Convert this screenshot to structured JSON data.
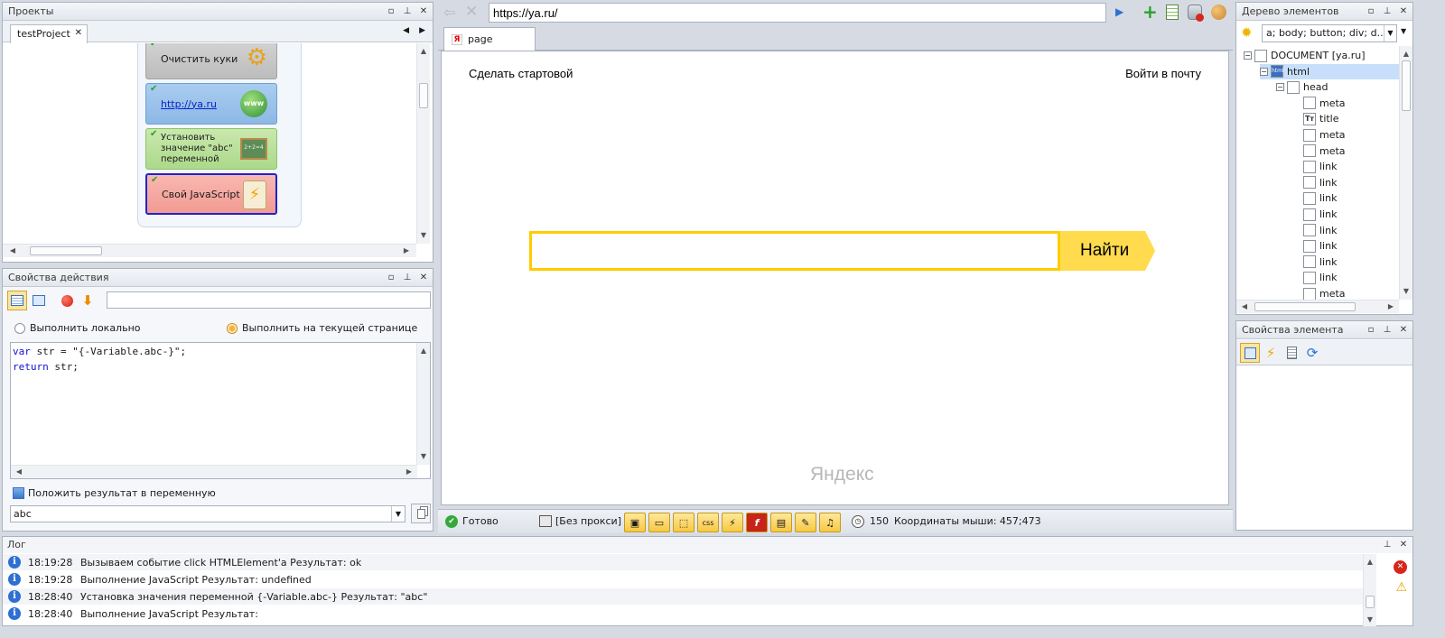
{
  "projects_panel": {
    "title": "Проекты",
    "tab": "testProject",
    "actions": [
      {
        "label": "Очистить куки",
        "icon": "gears-icon"
      },
      {
        "label": "http://ya.ru",
        "icon": "www-globe-icon"
      },
      {
        "label": "Установить значение \"abc\" переменной",
        "icon": "chalkboard-icon"
      },
      {
        "label": "Свой JavaScript код",
        "icon": "scroll-lightning-icon"
      }
    ]
  },
  "action_props": {
    "title": "Свойства действия",
    "radio_local": "Выполнить локально",
    "radio_page": "Выполнить на текущей странице",
    "code_line1_kw": "var",
    "code_line1_rest": " str = \"{-Variable.abc-}\";",
    "code_line2_kw": "return",
    "code_line2_rest": " str;",
    "checkbox_label": "Положить результат в переменную",
    "variable_value": "abc"
  },
  "browser": {
    "url": "https://ya.ru/",
    "tab": "page",
    "link_left": "Сделать стартовой",
    "link_right": "Войти в почту",
    "search_button": "Найти",
    "logo": "Яндекс"
  },
  "statusbar": {
    "status": "Готово",
    "proxy": "[Без прокси]",
    "timeout": "150",
    "mouse": "Координаты мыши: 457;473"
  },
  "dom_tree": {
    "title": "Дерево элементов",
    "filter": "a; body; button; div; d...",
    "nodes": [
      {
        "label": "DOCUMENT [ya.ru]",
        "level": 0
      },
      {
        "label": "html",
        "level": 1
      },
      {
        "label": "head",
        "level": 2
      },
      {
        "label": "meta",
        "level": 3
      },
      {
        "label": "title",
        "level": 3
      },
      {
        "label": "meta",
        "level": 3
      },
      {
        "label": "meta",
        "level": 3
      },
      {
        "label": "link",
        "level": 3
      },
      {
        "label": "link",
        "level": 3
      },
      {
        "label": "link",
        "level": 3
      },
      {
        "label": "link",
        "level": 3
      },
      {
        "label": "link",
        "level": 3
      },
      {
        "label": "link",
        "level": 3
      },
      {
        "label": "link",
        "level": 3
      },
      {
        "label": "link",
        "level": 3
      },
      {
        "label": "meta",
        "level": 3
      }
    ]
  },
  "element_props": {
    "title": "Свойства элемента"
  },
  "log": {
    "title": "Лог",
    "rows": [
      {
        "time": "18:19:28",
        "text": "Вызываем событие click HTMLElement'a  Результат: ok"
      },
      {
        "time": "18:19:28",
        "text": "Выполнение JavaScript  Результат: undefined"
      },
      {
        "time": "18:28:40",
        "text": "Установка значения переменной {-Variable.abc-}  Результат: \"abc\""
      },
      {
        "time": "18:28:40",
        "text": "Выполнение JavaScript  Результат:"
      }
    ]
  },
  "colors": {
    "accent_yellow": "#ffdb4d",
    "search_border": "#ffcc00",
    "selected_row": "#c7dffb",
    "cube_js": "#f5a6a0",
    "cube_var": "#b8df9b",
    "cube_nav": "#9cc3ea",
    "cube_cookie": "#c7c7c7"
  }
}
